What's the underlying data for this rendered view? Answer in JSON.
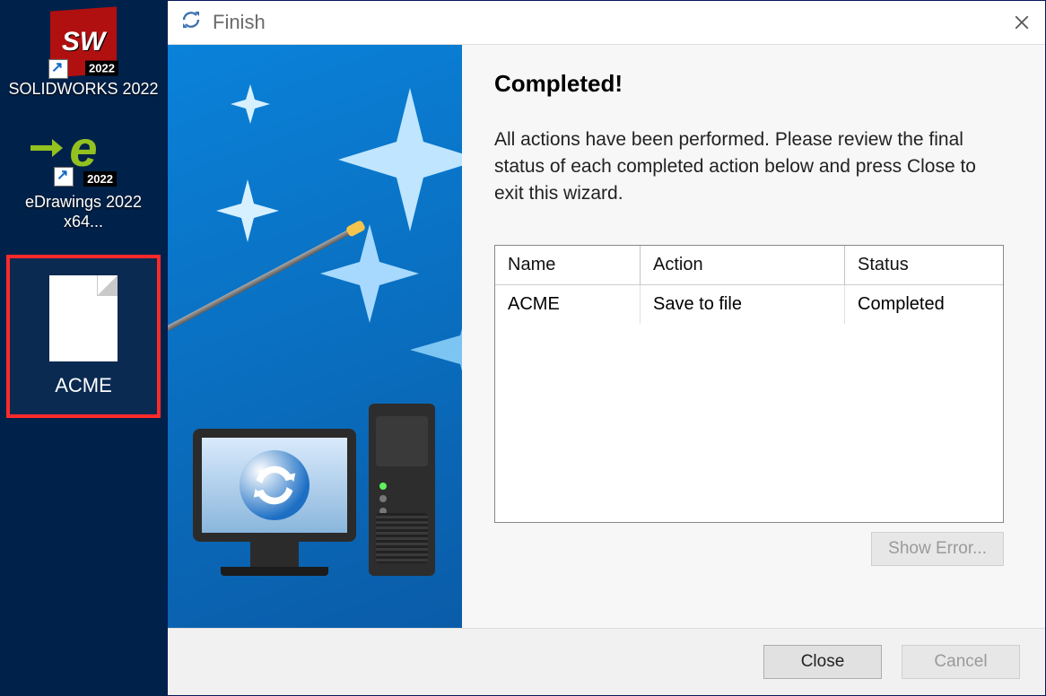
{
  "desktop": {
    "items": [
      {
        "label": "SOLIDWORKS 2022",
        "year_badge": "2022"
      },
      {
        "label": "eDrawings 2022 x64...",
        "year_badge": "2022"
      },
      {
        "label": "ACME"
      }
    ]
  },
  "dialog": {
    "title": "Finish",
    "heading": "Completed!",
    "description": "All actions have been performed. Please review the final status of each completed action below and press Close to exit this wizard.",
    "table": {
      "columns": [
        "Name",
        "Action",
        "Status"
      ],
      "rows": [
        {
          "name": "ACME",
          "action": "Save to file",
          "status": "Completed"
        }
      ]
    },
    "buttons": {
      "show_error": "Show Error...",
      "close": "Close",
      "cancel": "Cancel"
    }
  }
}
